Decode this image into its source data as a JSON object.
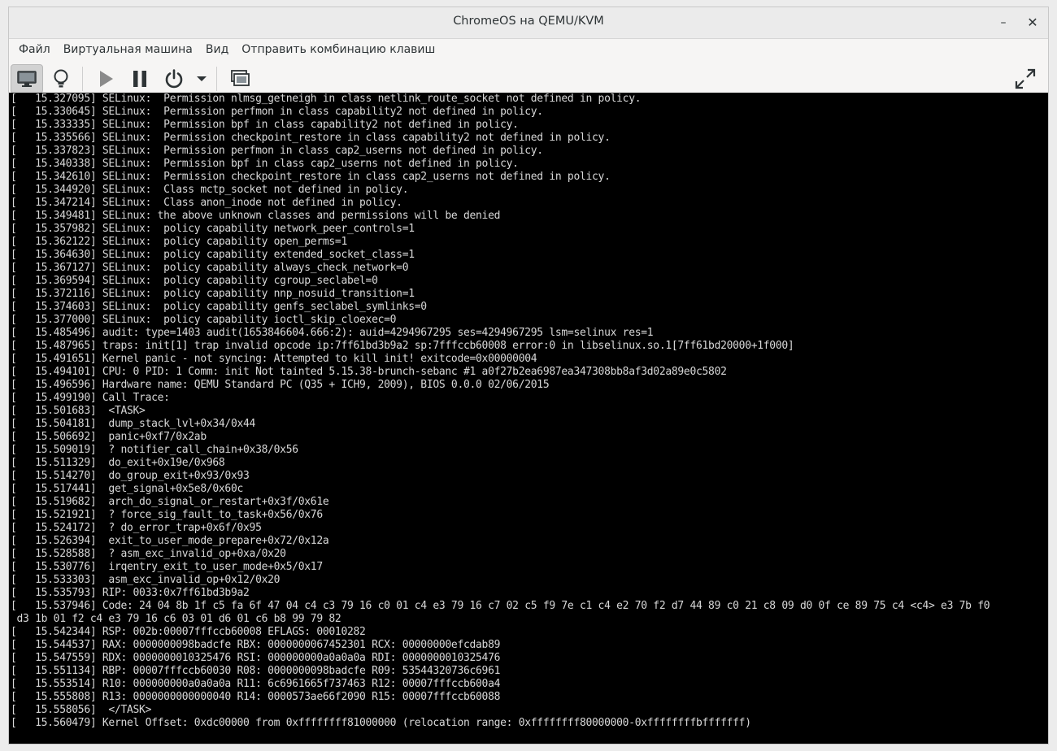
{
  "window": {
    "title": "ChromeOS на QEMU/KVM",
    "minimize_glyph": "–",
    "close_glyph": "✕"
  },
  "menubar": {
    "items": [
      {
        "label": "Файл"
      },
      {
        "label": "Виртуальная машина"
      },
      {
        "label": "Вид"
      },
      {
        "label": "Отправить комбинацию клавиш"
      }
    ]
  },
  "toolbar": {
    "buttons": [
      {
        "icon": "monitor-icon",
        "active": true
      },
      {
        "icon": "lightbulb-icon",
        "active": false
      },
      {
        "icon": "play-icon",
        "active": false
      },
      {
        "icon": "pause-icon",
        "active": false
      },
      {
        "icon": "power-icon",
        "active": false
      },
      {
        "icon": "dropdown-arrow-icon",
        "active": false
      },
      {
        "icon": "screenshot-icon",
        "active": false
      },
      {
        "icon": "fullscreen-icon",
        "active": false
      }
    ],
    "colors": {
      "icon": "#2e3436",
      "play_disabled": "#8a8a8a"
    }
  },
  "console": {
    "background": "#000000",
    "foreground": "#d8d8d8",
    "lines": [
      "[   15.327095] SELinux:  Permission nlmsg_getneigh in class netlink_route_socket not defined in policy.",
      "[   15.330645] SELinux:  Permission perfmon in class capability2 not defined in policy.",
      "[   15.333335] SELinux:  Permission bpf in class capability2 not defined in policy.",
      "[   15.335566] SELinux:  Permission checkpoint_restore in class capability2 not defined in policy.",
      "[   15.337823] SELinux:  Permission perfmon in class cap2_userns not defined in policy.",
      "[   15.340338] SELinux:  Permission bpf in class cap2_userns not defined in policy.",
      "[   15.342610] SELinux:  Permission checkpoint_restore in class cap2_userns not defined in policy.",
      "[   15.344920] SELinux:  Class mctp_socket not defined in policy.",
      "[   15.347214] SELinux:  Class anon_inode not defined in policy.",
      "[   15.349481] SELinux: the above unknown classes and permissions will be denied",
      "[   15.357982] SELinux:  policy capability network_peer_controls=1",
      "[   15.362122] SELinux:  policy capability open_perms=1",
      "[   15.364630] SELinux:  policy capability extended_socket_class=1",
      "[   15.367127] SELinux:  policy capability always_check_network=0",
      "[   15.369594] SELinux:  policy capability cgroup_seclabel=0",
      "[   15.372116] SELinux:  policy capability nnp_nosuid_transition=1",
      "[   15.374603] SELinux:  policy capability genfs_seclabel_symlinks=0",
      "[   15.377000] SELinux:  policy capability ioctl_skip_cloexec=0",
      "[   15.485496] audit: type=1403 audit(1653846604.666:2): auid=4294967295 ses=4294967295 lsm=selinux res=1",
      "[   15.487965] traps: init[1] trap invalid opcode ip:7ff61bd3b9a2 sp:7fffccb60008 error:0 in libselinux.so.1[7ff61bd20000+1f000]",
      "[   15.491651] Kernel panic - not syncing: Attempted to kill init! exitcode=0x00000004",
      "[   15.494101] CPU: 0 PID: 1 Comm: init Not tainted 5.15.38-brunch-sebanc #1 a0f27b2ea6987ea347308bb8af3d02a89e0c5802",
      "[   15.496596] Hardware name: QEMU Standard PC (Q35 + ICH9, 2009), BIOS 0.0.0 02/06/2015",
      "[   15.499190] Call Trace:",
      "[   15.501683]  <TASK>",
      "[   15.504181]  dump_stack_lvl+0x34/0x44",
      "[   15.506692]  panic+0xf7/0x2ab",
      "[   15.509019]  ? notifier_call_chain+0x38/0x56",
      "[   15.511329]  do_exit+0x19e/0x968",
      "[   15.514270]  do_group_exit+0x93/0x93",
      "[   15.517441]  get_signal+0x5e8/0x60c",
      "[   15.519682]  arch_do_signal_or_restart+0x3f/0x61e",
      "[   15.521921]  ? force_sig_fault_to_task+0x56/0x76",
      "[   15.524172]  ? do_error_trap+0x6f/0x95",
      "[   15.526394]  exit_to_user_mode_prepare+0x72/0x12a",
      "[   15.528588]  ? asm_exc_invalid_op+0xa/0x20",
      "[   15.530776]  irqentry_exit_to_user_mode+0x5/0x17",
      "[   15.533303]  asm_exc_invalid_op+0x12/0x20",
      "[   15.535793] RIP: 0033:0x7ff61bd3b9a2",
      "[   15.537946] Code: 24 04 8b 1f c5 fa 6f 47 04 c4 c3 79 16 c0 01 c4 e3 79 16 c7 02 c5 f9 7e c1 c4 e2 70 f2 d7 44 89 c0 21 c8 09 d0 0f ce 89 75 c4 <c4> e3 7b f0",
      " d3 1b 01 f2 c4 e3 79 16 c6 03 01 d6 01 c6 b8 99 79 82",
      "[   15.542344] RSP: 002b:00007fffccb60008 EFLAGS: 00010282",
      "[   15.544537] RAX: 0000000098badcfe RBX: 0000000067452301 RCX: 00000000efcdab89",
      "[   15.547559] RDX: 0000000010325476 RSI: 000000000a0a0a0a RDI: 0000000010325476",
      "[   15.551134] RBP: 00007fffccb60030 R08: 0000000098badcfe R09: 53544320736c6961",
      "[   15.553514] R10: 000000000a0a0a0a R11: 6c6961665f737463 R12: 00007fffccb600a4",
      "[   15.555808] R13: 0000000000000040 R14: 0000573ae66f2090 R15: 00007fffccb60088",
      "[   15.558056]  </TASK>",
      "[   15.560479] Kernel Offset: 0xdc00000 from 0xffffffff81000000 (relocation range: 0xffffffff80000000-0xffffffffbfffffff)"
    ]
  }
}
